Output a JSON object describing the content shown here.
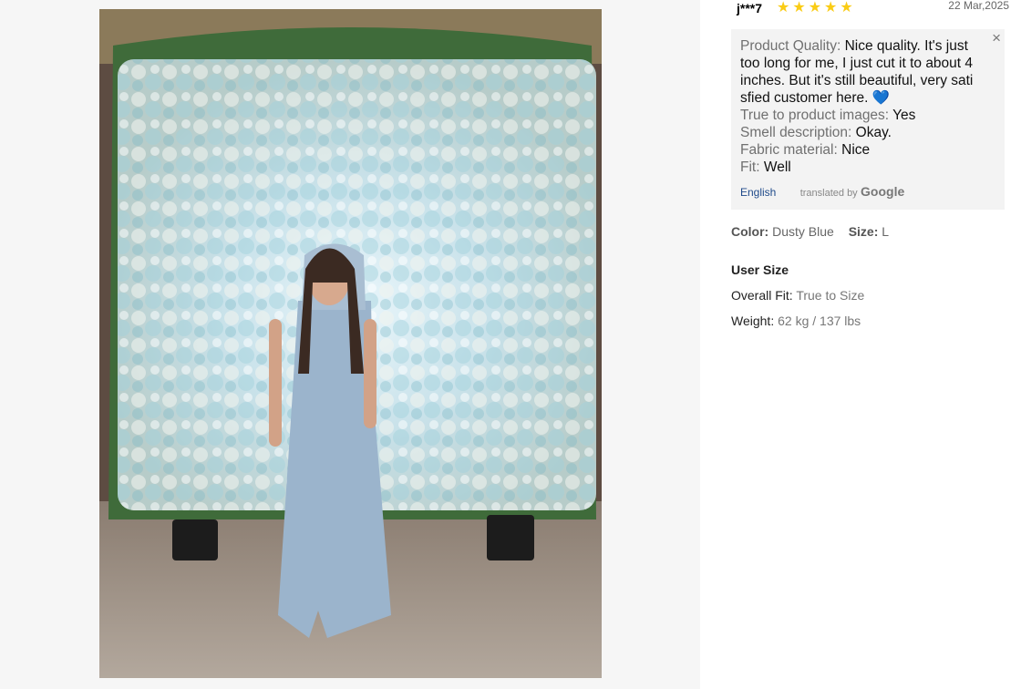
{
  "review": {
    "username": "j***7",
    "rating": 5,
    "stars": "★★★★★",
    "date": "22 Mar,2025",
    "close_glyph": "×",
    "body_lines": [
      {
        "key": "Product Quality: ",
        "text": "Nice quality. It's just"
      },
      {
        "key": "",
        "text": "too long for me, I just cut it to about 4"
      },
      {
        "key": "",
        "text": "inches. But it's still beautiful, very sati"
      },
      {
        "key": "",
        "text": "sfied customer here. "
      },
      {
        "key": "True to product images: ",
        "text": "Yes"
      },
      {
        "key": "Smell description: ",
        "text": "Okay."
      },
      {
        "key": "Fabric material: ",
        "text": "Nice"
      },
      {
        "key": "Fit: ",
        "text": "Well"
      }
    ],
    "heart": "💙",
    "language": "English",
    "translated_by": "translated by",
    "google": "Google"
  },
  "product": {
    "color_label": "Color:",
    "color_value": "Dusty Blue",
    "size_label": "Size:",
    "size_value": "L"
  },
  "user_size": {
    "title": "User Size",
    "fit_label": "Overall Fit:",
    "fit_value": "True to Size",
    "weight_label": "Weight:",
    "weight_value": "62 kg / 137 lbs"
  }
}
